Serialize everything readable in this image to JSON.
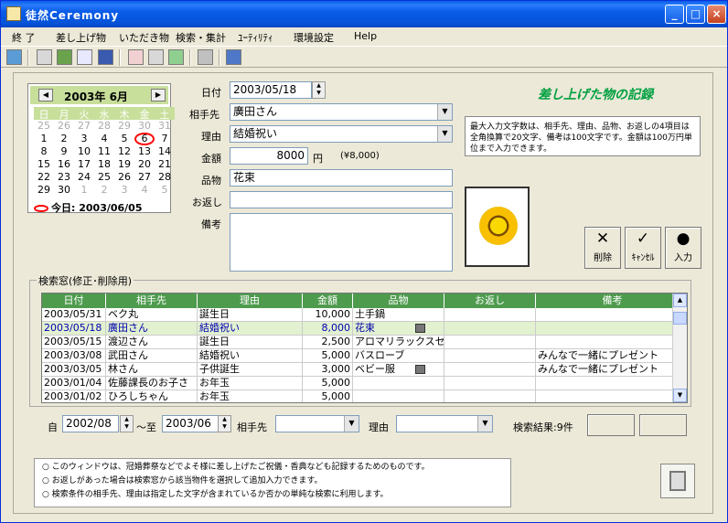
{
  "window": {
    "title": "徒然Ceremony"
  },
  "menu": [
    "終 了",
    "差し上げ物",
    "いただき物",
    "検索・集計",
    "ﾕｰﾃｨﾘﾃｨ",
    "環境設定",
    "Help"
  ],
  "toolbar": [
    "exit-icon",
    "record-icon",
    "list-icon",
    "edit-icon",
    "report-icon",
    "search-icon",
    "print-icon",
    "sheet-icon",
    "card-icon",
    "book-icon"
  ],
  "calendar": {
    "title": "2003年 6月",
    "weekdays": [
      "日",
      "月",
      "火",
      "水",
      "木",
      "金",
      "土"
    ],
    "days": [
      "25",
      "26",
      "27",
      "28",
      "29",
      "30",
      "31",
      "1",
      "2",
      "3",
      "4",
      "5",
      "6",
      "7",
      "8",
      "9",
      "10",
      "11",
      "12",
      "13",
      "14",
      "15",
      "16",
      "17",
      "18",
      "19",
      "20",
      "21",
      "22",
      "23",
      "24",
      "25",
      "26",
      "27",
      "28",
      "29",
      "30",
      "1",
      "2",
      "3",
      "4",
      "5"
    ],
    "today": "今日: 2003/06/05",
    "prev": "◀",
    "next": "▶"
  },
  "form": {
    "date_label": "日付",
    "date": "2003/05/18",
    "partner_label": "相手先",
    "partner": "廣田さん",
    "reason_label": "理由",
    "reason": "結婚祝い",
    "amount_label": "金額",
    "amount": "8000",
    "yen": "円",
    "amount_note": "(¥8,000)",
    "item_label": "品物",
    "item": "花束",
    "return_label": "お返し",
    "return": "",
    "memo_label": "備考",
    "memo": ""
  },
  "header": {
    "section_title": "差し上げた物の記録"
  },
  "info": "最大入力文字数は、相手先、理由、品物、お返しの4項目は全角換算で20文字、備考は100文字です。金額は100万円単位まで入力できます。",
  "buttons": {
    "delete": "削除",
    "cancel": "ｷｬﾝｾﾙ",
    "enter": "入力",
    "delete_icon": "✕",
    "cancel_icon": "✓",
    "enter_icon": "●"
  },
  "search": {
    "title": "検索窓(修正･削除用)",
    "from_label": "自",
    "from": "2002/08",
    "to_label": "～至",
    "to": "2003/06",
    "partner_label": "相手先",
    "reason_label": "理由",
    "result": "検索結果:9件"
  },
  "table": {
    "columns": [
      "日付",
      "相手先",
      "理由",
      "金額",
      "品物",
      "お返し",
      "備考"
    ],
    "rows": [
      [
        "2003/05/31",
        "ベク丸",
        "誕生日",
        "10,000",
        "土手鍋",
        "",
        ""
      ],
      [
        "2003/05/18",
        "廣田さん",
        "結婚祝い",
        "8,000",
        "花束",
        "",
        ""
      ],
      [
        "2003/05/15",
        "渡辺さん",
        "誕生日",
        "2,500",
        "アロマリラックスセ",
        "",
        ""
      ],
      [
        "2003/03/08",
        "武田さん",
        "結婚祝い",
        "5,000",
        "バスローブ",
        "",
        "みんなで一緒にプレゼント"
      ],
      [
        "2003/03/05",
        "林さん",
        "子供誕生",
        "3,000",
        "ベビー服",
        "",
        "みんなで一緒にプレゼント"
      ],
      [
        "2003/01/04",
        "佐藤課長のお子さ",
        "お年玉",
        "5,000",
        "",
        "",
        ""
      ],
      [
        "2003/01/02",
        "ひろしちゃん",
        "お年玉",
        "5,000",
        "",
        "",
        ""
      ]
    ]
  },
  "notes": [
    "○ このウィンドウは、冠婚葬祭などでよそ様に差し上げたご祝儀・香典なども記録するためのものです。",
    "○ お返しがあった場合は検索窓から該当物件を選択して追加入力できます。",
    "○ 検索条件の相手先、理由は指定した文字が含まれているか否かの単純な検索に利用します。"
  ]
}
